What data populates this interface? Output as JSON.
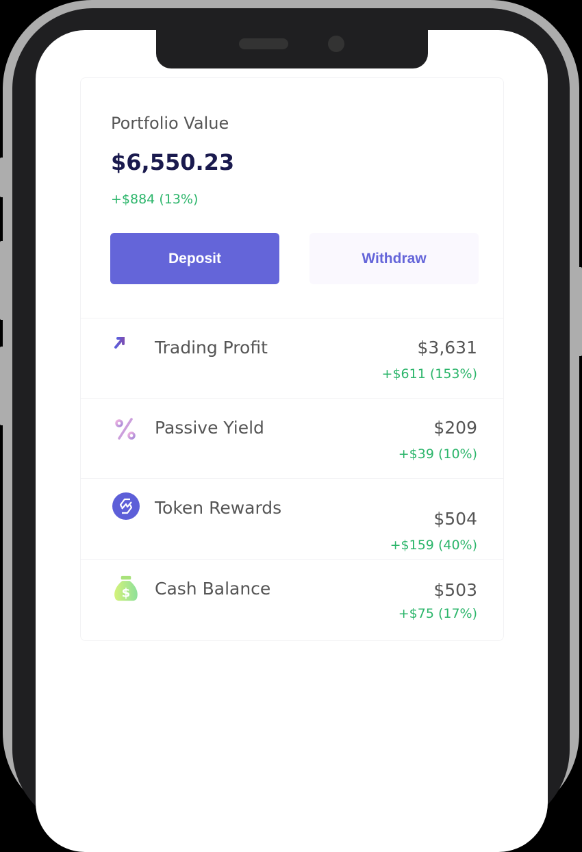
{
  "portfolio": {
    "label": "Portfolio Value",
    "value": "$6,550.23",
    "change": "+$884 (13%)"
  },
  "actions": {
    "deposit": "Deposit",
    "withdraw": "Withdraw"
  },
  "colors": {
    "accent": "#6465d9",
    "positive": "#2bb56a",
    "title": "#1a1a4e"
  },
  "items": [
    {
      "icon": "chart-up-icon",
      "name": "Trading Profit",
      "amount": "$3,631",
      "change": "+$611 (153%)"
    },
    {
      "icon": "percent-icon",
      "name": "Passive Yield",
      "amount": "$209",
      "change": "+$39 (10%)"
    },
    {
      "icon": "token-icon",
      "name": "Token Rewards",
      "amount": "$504",
      "change": "+$159 (40%)"
    },
    {
      "icon": "money-bag-icon",
      "name": "Cash Balance",
      "amount": "$503",
      "change": "+$75 (17%)"
    }
  ]
}
